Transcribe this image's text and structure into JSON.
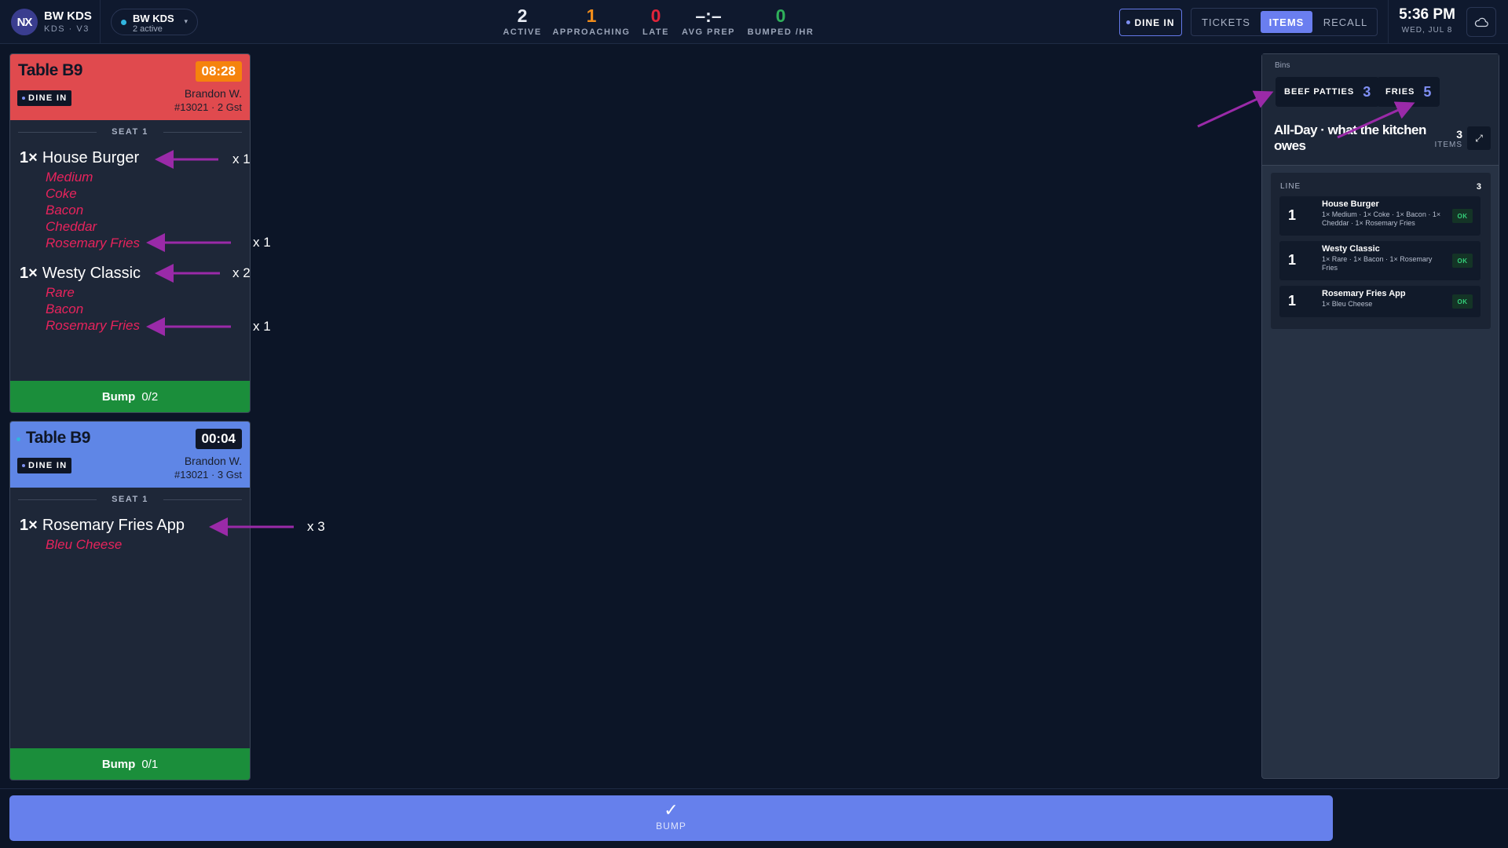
{
  "brand": {
    "logo": "NX",
    "name": "BW KDS",
    "sub": "KDS · V3"
  },
  "station": {
    "name": "BW KDS",
    "count": "2 active",
    "caret": "▾"
  },
  "stats": [
    {
      "value": "2",
      "label": "ACTIVE",
      "color": "#ffffff"
    },
    {
      "value": "1",
      "label": "APPROACHING",
      "color": "#f08c1a"
    },
    {
      "value": "0",
      "label": "LATE",
      "color": "#e0243a"
    },
    {
      "value": "–:–",
      "label": "AVG PREP",
      "color": "#ffffff"
    },
    {
      "value": "0",
      "label": "BUMPED /HR",
      "color": "#2fb05a"
    }
  ],
  "service_filter": "DINE IN",
  "view_tabs": [
    {
      "label": "TICKETS",
      "active": false
    },
    {
      "label": "ITEMS",
      "active": true
    },
    {
      "label": "RECALL",
      "active": false
    }
  ],
  "clock": {
    "time": "5:36 PM",
    "date": "WED, JUL 8"
  },
  "tickets": [
    {
      "title": "Table B9",
      "timer": "08:28",
      "header_color": "#e04a4e",
      "timer_bg": "#f5830d",
      "tag": "DINE IN",
      "server": "Brandon W.",
      "order": "#13021 · 2 Gst",
      "seat": "SEAT 1",
      "lines": [
        {
          "qty": "1×",
          "name": "House Burger",
          "mods": [
            "Medium",
            "Coke",
            "Bacon",
            "Cheddar",
            "Rosemary Fries"
          ]
        },
        {
          "qty": "1×",
          "name": "Westy Classic",
          "mods": [
            "Rare",
            "Bacon",
            "Rosemary Fries"
          ]
        }
      ],
      "bump_label": "Bump",
      "bump_progress": "0/2"
    },
    {
      "title": "Table B9",
      "timer": "00:04",
      "header_color": "#5f86e6",
      "timer_bg": "#0f1626",
      "tag": "DINE IN",
      "server": "Brandon W.",
      "order": "#13021 · 3 Gst",
      "seat": "SEAT 1",
      "lines": [
        {
          "qty": "1×",
          "name": "Rosemary Fries App",
          "mods": [
            "Bleu Cheese"
          ]
        }
      ],
      "bump_label": "Bump",
      "bump_progress": "0/1"
    }
  ],
  "annotations": [
    "x 1",
    "x 1",
    "x 2",
    "x 1",
    "x 3"
  ],
  "panel": {
    "bins_label": "Bins",
    "bins": [
      {
        "name": "BEEF PATTIES",
        "count": "3"
      },
      {
        "name": "FRIES",
        "count": "5"
      }
    ],
    "allday_title": "All-Day · what the kitchen owes",
    "allday_count": "3",
    "allday_count_label": "ITEMS",
    "collapse_icon": "⤢",
    "line_label": "LINE",
    "line_count": "3",
    "items": [
      {
        "qty": "1",
        "name": "House Burger",
        "mods": "1× Medium · 1× Coke · 1× Bacon · 1× Cheddar · 1× Rosemary Fries",
        "status": "OK"
      },
      {
        "qty": "1",
        "name": "Westy Classic",
        "mods": "1× Rare · 1× Bacon · 1× Rosemary Fries",
        "status": "OK"
      },
      {
        "qty": "1",
        "name": "Rosemary Fries App",
        "mods": "1× Bleu Cheese",
        "status": "OK"
      }
    ]
  },
  "bump_all": {
    "icon": "✓",
    "label": "BUMP"
  },
  "colors": {
    "accent": "#6a7ef0",
    "annotation_arrow": "#9a2aa8",
    "modifier": "#e8235c",
    "bump": "#1b8e3b"
  }
}
